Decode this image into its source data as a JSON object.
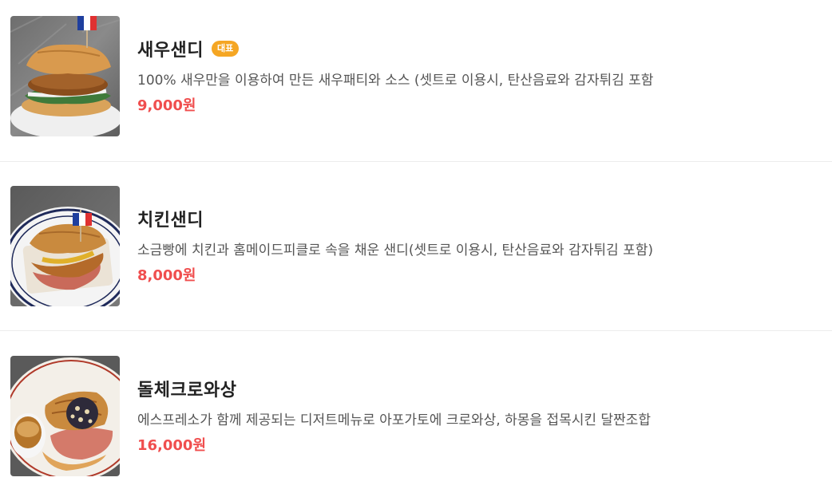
{
  "menu": {
    "items": [
      {
        "name": "새우샌디",
        "badge": "대표",
        "description": "100% 새우만을 이용하여 만든 새우패티와 소스 (셋트로 이용시, 탄산음료와 감자튀김 포함",
        "price": "9,000원",
        "image": "shrimp-sandwich-photo"
      },
      {
        "name": "치킨샌디",
        "description": "소금빵에 치킨과 홈메이드피클로 속을 채운 샌디(셋트로 이용시, 탄산음료와 감자튀김 포함)",
        "price": "8,000원",
        "image": "chicken-sandwich-photo"
      },
      {
        "name": "돌체크로와상",
        "description": "에스프레소가 함께 제공되는 디저트메뉴로 아포가토에 크로와상, 하몽을 접목시킨 달짠조합",
        "price": "16,000원",
        "image": "dolce-croissant-photo"
      }
    ]
  },
  "colors": {
    "price": "#f04e4e",
    "badge": "#f5a623",
    "name": "#222222",
    "description": "#555555"
  }
}
